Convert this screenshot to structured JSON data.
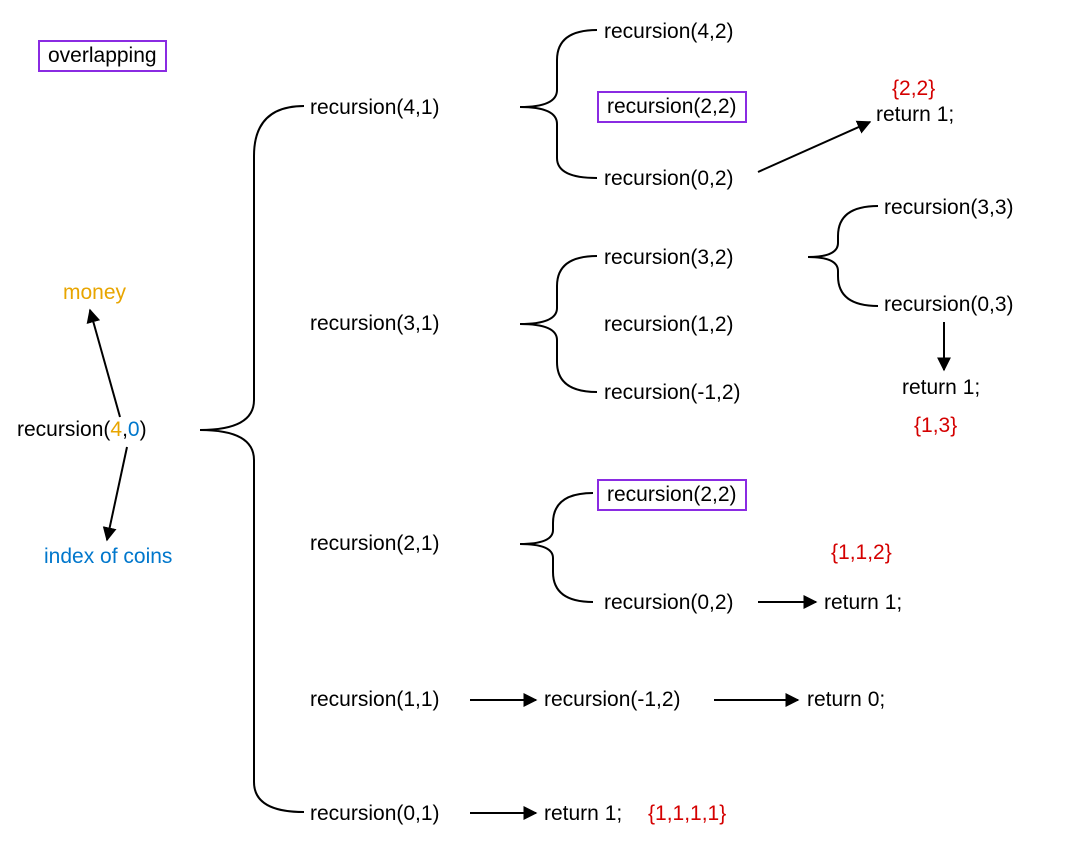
{
  "legend": {
    "overlapping": "overlapping"
  },
  "labels": {
    "money": "money",
    "index_of_coins": "index of coins"
  },
  "root": {
    "prefix": "recursion(",
    "arg1": "4",
    "sep": ",",
    "arg2": "0",
    "suffix": ")"
  },
  "nodes": {
    "r41": "recursion(4,1)",
    "r42": "recursion(4,2)",
    "r22a": "recursion(2,2)",
    "r02a": "recursion(0,2)",
    "ret1a": "return 1;",
    "set22": "{2,2}",
    "r31": "recursion(3,1)",
    "r32": "recursion(3,2)",
    "r12": "recursion(1,2)",
    "rn12a": "recursion(-1,2)",
    "r33": "recursion(3,3)",
    "r03": "recursion(0,3)",
    "ret1b": "return 1;",
    "set13": "{1,3}",
    "r21": "recursion(2,1)",
    "r22b": "recursion(2,2)",
    "r02b": "recursion(0,2)",
    "ret1c": "return 1;",
    "set112": "{1,1,2}",
    "r11": "recursion(1,1)",
    "rn12b": "recursion(-1,2)",
    "ret0": "return 0;",
    "r01": "recursion(0,1)",
    "ret1d": "return 1;",
    "set1111": "{1,1,1,1}"
  }
}
